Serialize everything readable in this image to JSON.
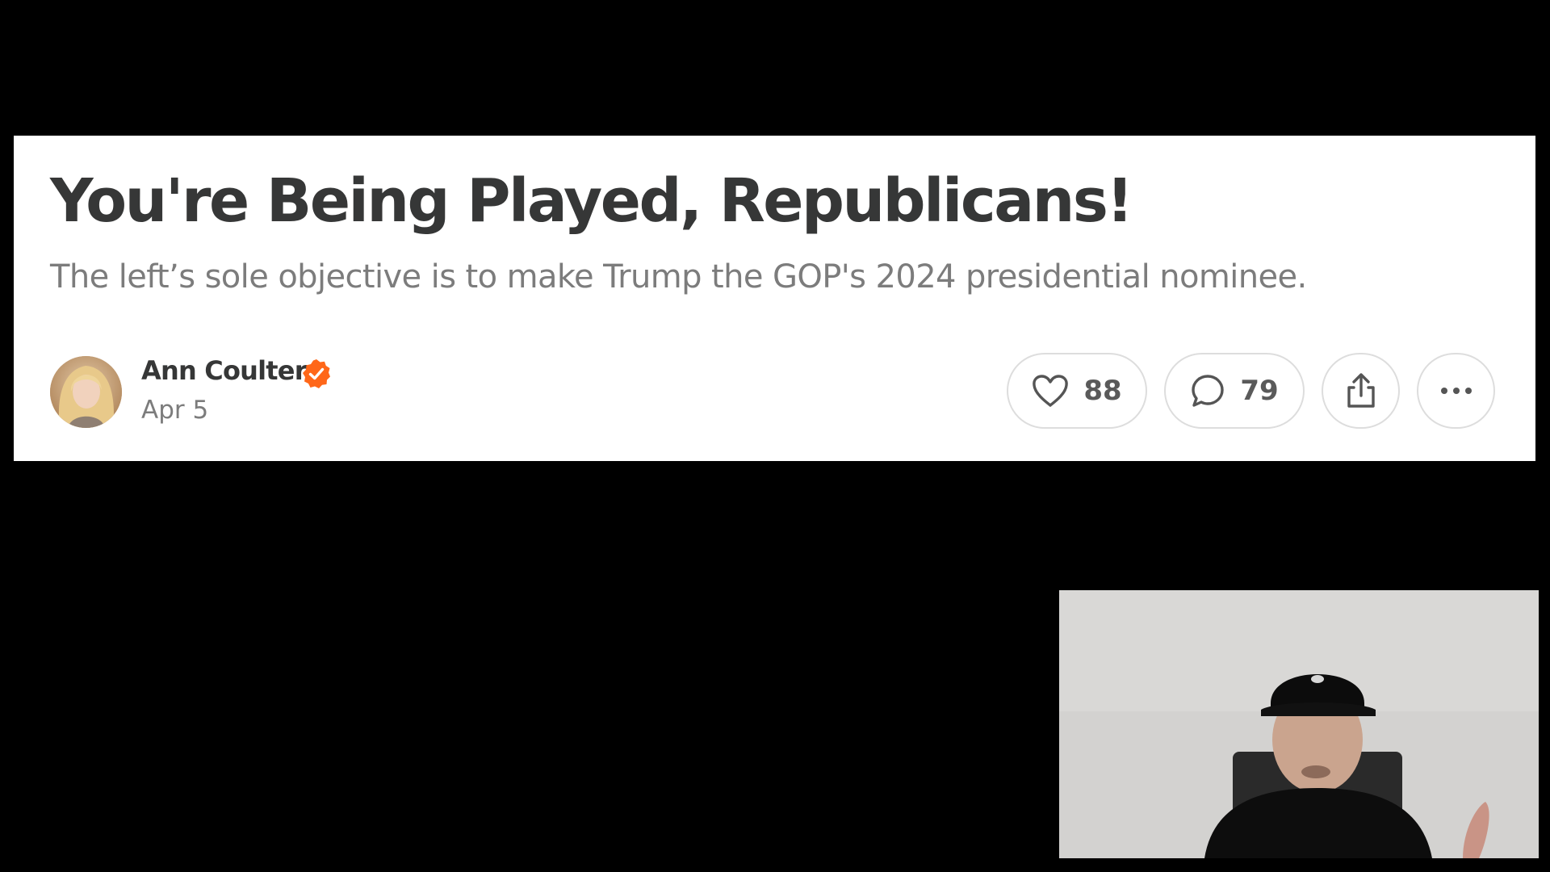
{
  "article": {
    "title": "You're Being Played, Republicans!",
    "subtitle": "The left’s sole objective is to make Trump the GOP's 2024 presidential nominee.",
    "author": "Ann Coulter",
    "date": "Apr 5"
  },
  "actions": {
    "likes": "88",
    "comments": "79"
  },
  "icons": {
    "like": "heart-icon",
    "comment": "speech-bubble-icon",
    "share": "share-icon",
    "more": "ellipsis-icon",
    "verified": "verified-check-icon"
  },
  "colors": {
    "background": "#000000",
    "card": "#ffffff",
    "title": "#363737",
    "muted": "#7c7c7c",
    "verified": "#ff6719"
  }
}
